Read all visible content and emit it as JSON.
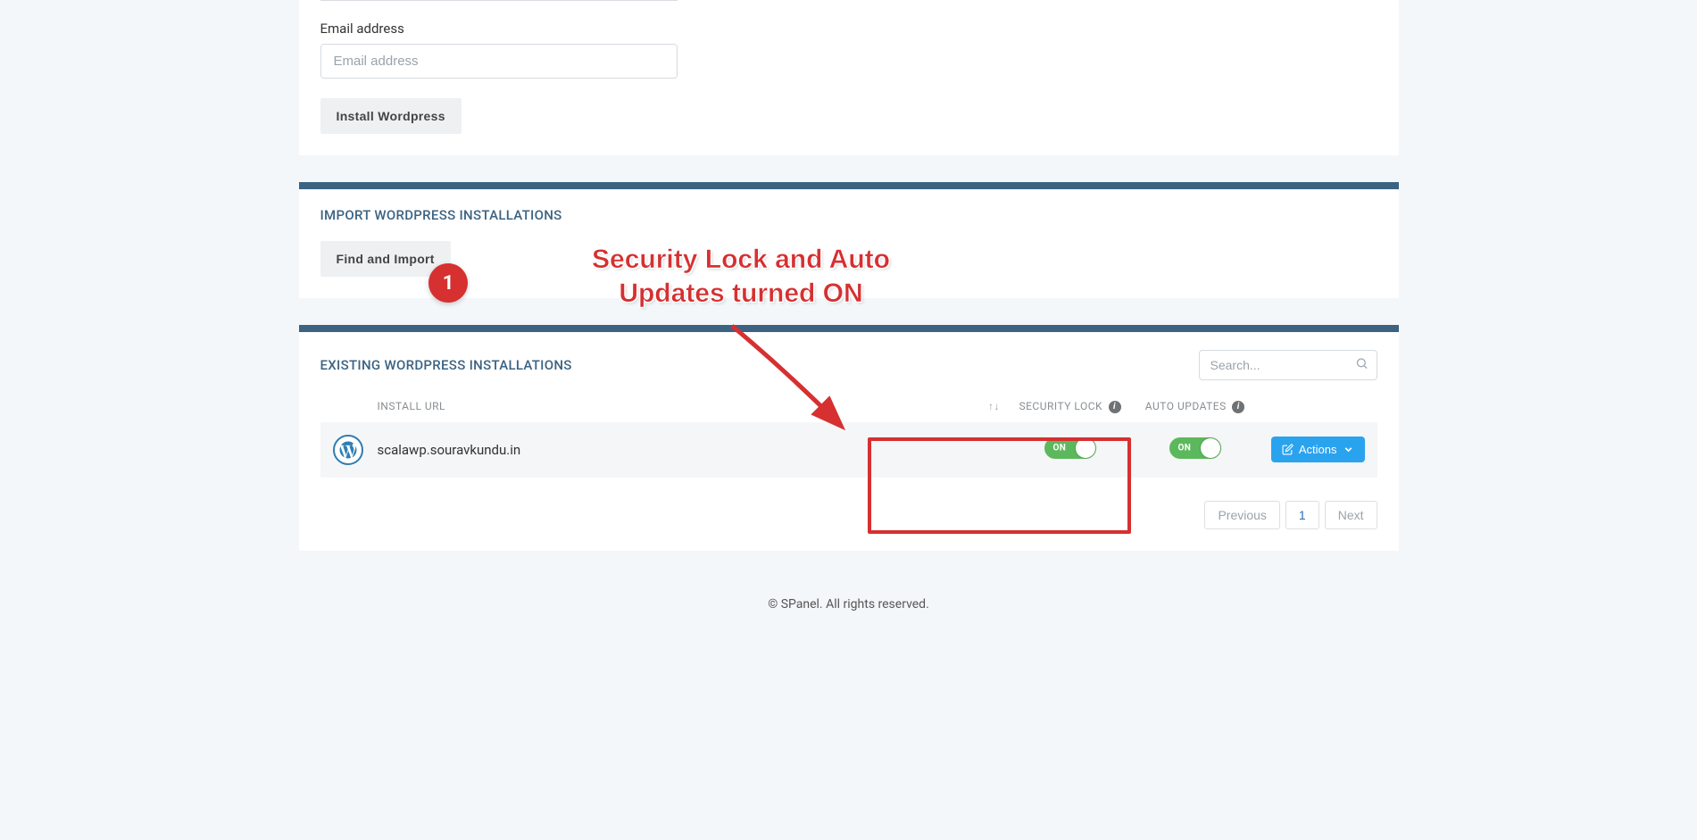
{
  "install_form": {
    "email_label": "Email address",
    "email_placeholder": "Email address",
    "install_button": "Install Wordpress"
  },
  "import_section": {
    "title": "IMPORT WORDPRESS INSTALLATIONS",
    "find_import_button": "Find and Import"
  },
  "existing_section": {
    "title": "EXISTING WORDPRESS INSTALLATIONS",
    "search_placeholder": "Search...",
    "columns": {
      "install_url": "INSTALL URL",
      "sort_indicator": "↑↓",
      "security_lock": "SECURITY LOCK",
      "auto_updates": "AUTO UPDATES"
    },
    "rows": [
      {
        "url": "scalawp.souravkundu.in",
        "security_lock": "ON",
        "auto_updates": "ON",
        "actions_label": "Actions"
      }
    ],
    "pagination": {
      "previous": "Previous",
      "page": "1",
      "next": "Next"
    }
  },
  "footer": "© SPanel. All rights reserved.",
  "annotation": {
    "badge": "1",
    "text_line1": "Security Lock and Auto",
    "text_line2": "Updates turned ON"
  }
}
